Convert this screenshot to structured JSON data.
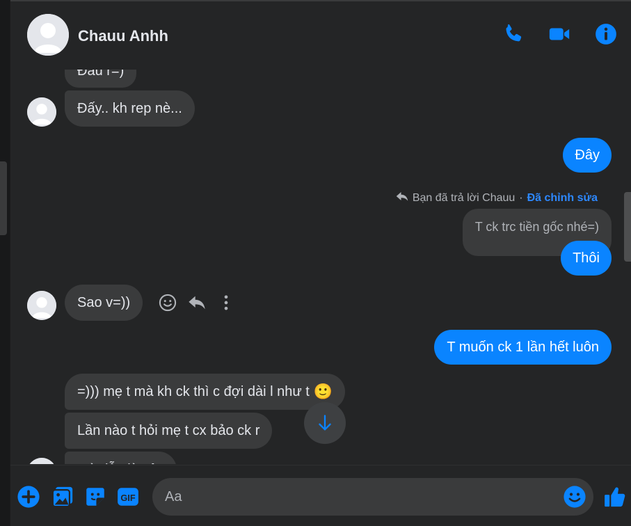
{
  "header": {
    "contact_name": "Chauu Anhh",
    "actions": [
      "phone-icon",
      "video-camera-icon",
      "info-icon"
    ]
  },
  "messages": {
    "m0": "Đâu r=)",
    "m1": "Đấy.. kh rep nè...",
    "m2": "Đây",
    "reply_meta": {
      "text": "Bạn đã trả lời Chauu",
      "separator": "·",
      "edited": "Đã chỉnh sửa"
    },
    "quoted": "T ck trc tiền gốc nhé=)",
    "m3": "Thôi",
    "m4": "Sao v=))",
    "m5": "T muốn ck 1 lần hết luôn",
    "m6": "=))) mẹ t mà kh ck thì c đợi dài l như t",
    "m6_emoji": "🙂",
    "m7": "Lần nào t hỏi mẹ t cx bảo ck r",
    "m8": "Mà dẫu là vậy"
  },
  "composer": {
    "placeholder": "Aa",
    "icons": [
      "plus-icon",
      "image-icon",
      "sticker-icon",
      "gif-icon",
      "emoji-icon",
      "like-icon"
    ],
    "gif_label": "GIF"
  },
  "colors": {
    "accent": "#0a84ff",
    "background": "#242526",
    "bubble_received": "#3a3b3c"
  }
}
